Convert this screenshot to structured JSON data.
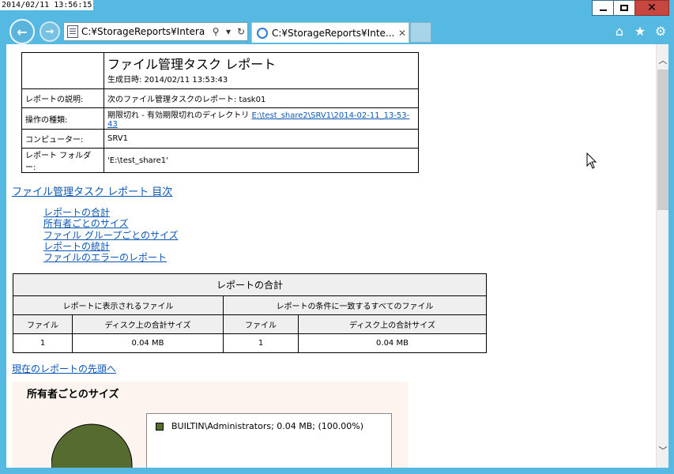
{
  "timestamp": "2014/02/11 13:56:15",
  "address_text": "C:¥StorageReports¥Intera",
  "tab_title": "C:¥StorageReports¥Inte...",
  "report": {
    "title": "ファイル管理タスク レポート",
    "generated": "生成日時: 2014/02/11 13:53:43",
    "rows": [
      {
        "label": "レポートの説明:",
        "value": "次のファイル管理タスクのレポート: task01"
      },
      {
        "label": "操作の種類:",
        "value": "期限切れ - 有効期限切れのディレクトリ",
        "link": "E:\\test_share2\\SRV1\\2014-02-11_13-53-43"
      },
      {
        "label": "コンピューター:",
        "value": "SRV1"
      },
      {
        "label": "レポート フォルダー:",
        "value": "'E:\\test_share1'"
      }
    ]
  },
  "toc": {
    "heading": "ファイル管理タスク レポート 目次",
    "items": [
      "レポートの合計",
      "所有者ごとのサイズ",
      "ファイル グループごとのサイズ",
      "レポートの統計",
      "ファイルのエラーのレポート"
    ]
  },
  "summary": {
    "title": "レポートの合計",
    "group1": "レポートに表示されるファイル",
    "group2": "レポートの条件に一致するすべてのファイル",
    "col_files": "ファイル",
    "col_size": "ディスク上の合計サイズ",
    "values": [
      "1",
      "0.04 MB",
      "1",
      "0.04 MB"
    ]
  },
  "back_link": "現在のレポートの先頭へ",
  "owner_section": {
    "title": "所有者ごとのサイズ",
    "legend": "BUILTIN\\Administrators; 0.04 MB; (100.00%)",
    "swatch_color": "#556b2f"
  }
}
